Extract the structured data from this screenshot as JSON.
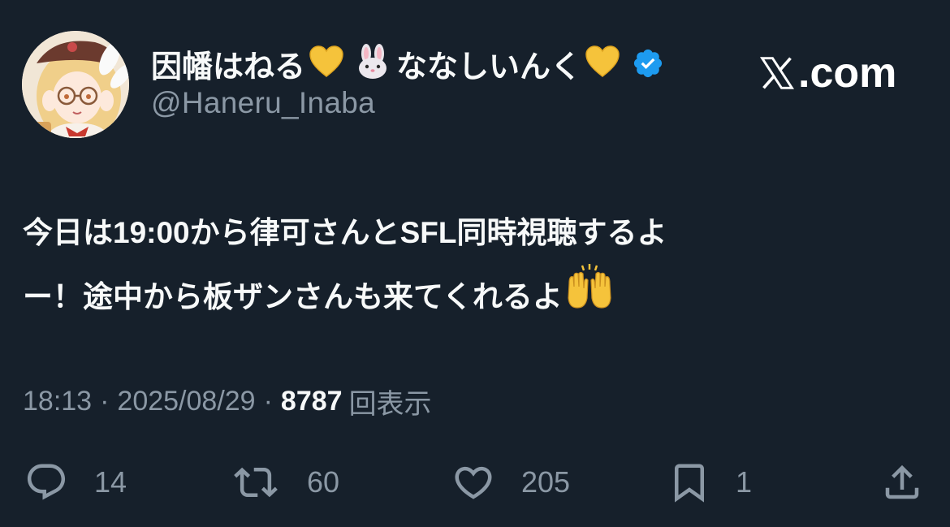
{
  "header": {
    "display_name_part1": "因幡はねる",
    "display_name_part2": "ななしいんく",
    "handle": "@Haneru_Inaba",
    "emoji_1": "yellow-heart",
    "emoji_2": "rabbit-face",
    "emoji_3": "yellow-heart",
    "verified_icon": "verified-badge-icon",
    "site": "X.com",
    "site_suffix": ".com"
  },
  "tweet": {
    "line1": "今日は19:00から律可さんとSFL同時視聴するよ",
    "line2_text": "ー！途中から板ザンさんも来てくれるよ",
    "line2_emoji": "raising-hands"
  },
  "meta": {
    "time": "18:13",
    "dot1": "·",
    "date": "2025/08/29",
    "dot2": "·",
    "views_count": "8787",
    "views_label": "回表示"
  },
  "actions": {
    "replies": {
      "icon": "reply-icon",
      "count": "14"
    },
    "reposts": {
      "icon": "repost-icon",
      "count": "60"
    },
    "likes": {
      "icon": "heart-icon",
      "count": "205"
    },
    "bookmarks": {
      "icon": "bookmark-icon",
      "count": "1"
    },
    "share": {
      "icon": "share-icon"
    }
  },
  "colors": {
    "background": "#16202b",
    "text_primary": "#f7f9f9",
    "text_secondary": "#8b98a5",
    "verified_blue": "#1d9bf0",
    "heart_yellow": "#f5c33b"
  }
}
